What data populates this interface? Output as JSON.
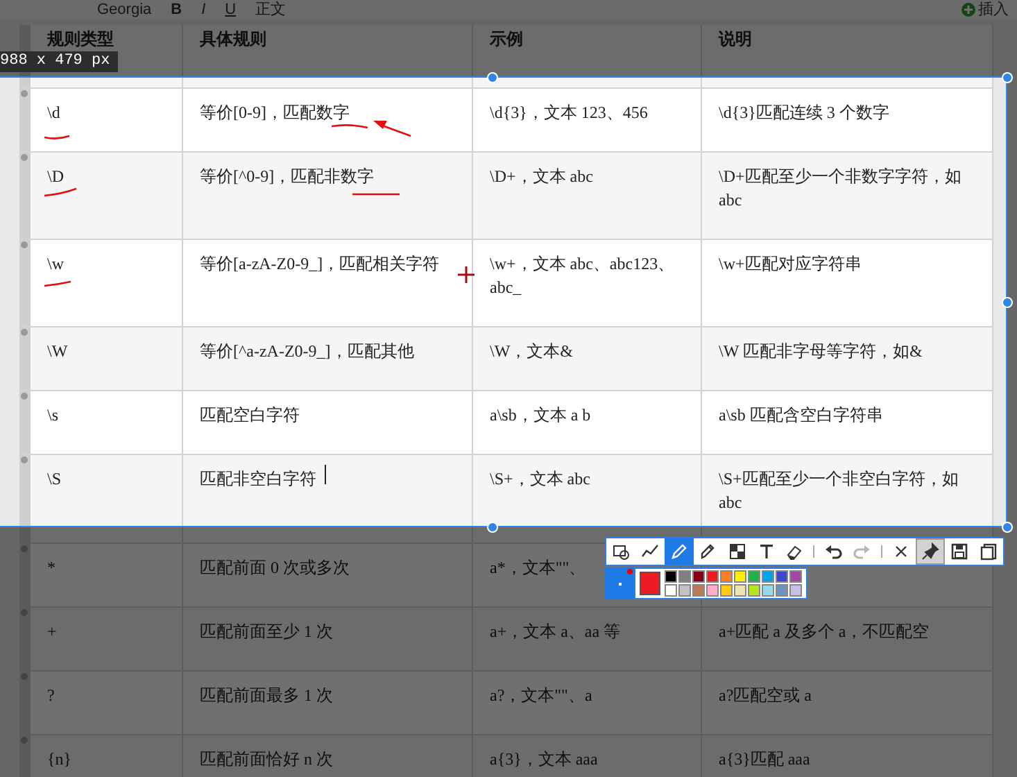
{
  "format_bar": {
    "items": [
      "Georgia",
      "B",
      "I",
      "U",
      "正文",
      "插入"
    ]
  },
  "table": {
    "columns": [
      "规则类型",
      "具体规则",
      "示例",
      "说明"
    ],
    "rows": [
      {
        "cells": [
          "\\d",
          "等价[0-9]，匹配数字",
          "\\d{3}，文本 123、456",
          "\\d{3}匹配连续 3 个数字"
        ]
      },
      {
        "cells": [
          "\\D",
          "等价[^0-9]，匹配非数字",
          "\\D+，文本 abc",
          "\\D+匹配至少一个非数字字符，如abc"
        ]
      },
      {
        "cells": [
          "\\w",
          "等价[a-zA-Z0-9_]，匹配相关字符",
          "\\w+，文本 abc、abc123、abc_",
          "\\w+匹配对应字符串"
        ]
      },
      {
        "cells": [
          "\\W",
          "等价[^a-zA-Z0-9_]，匹配其他",
          "\\W，文本&",
          "\\W 匹配非字母等字符，如&"
        ]
      },
      {
        "cells": [
          "\\s",
          "匹配空白字符",
          "a\\sb，文本 a  b",
          "a\\sb 匹配含空白字符串"
        ]
      },
      {
        "cells": [
          "\\S",
          "匹配非空白字符",
          "\\S+，文本 abc",
          "\\S+匹配至少一个非空白字符，如abc"
        ]
      },
      {
        "cells": [
          "*",
          "匹配前面 0 次或多次",
          "a*，文本\"\"、",
          ""
        ]
      },
      {
        "cells": [
          "+",
          "匹配前面至少 1 次",
          "a+，文本 a、aa 等",
          "a+匹配 a 及多个 a，不匹配空"
        ]
      },
      {
        "cells": [
          "?",
          "匹配前面最多 1 次",
          "a?，文本\"\"、a",
          "a?匹配空或 a"
        ]
      },
      {
        "cells": [
          "{n}",
          "匹配前面恰好 n 次",
          "a{3}，文本 aaa",
          "a{3}匹配 aaa"
        ]
      }
    ]
  },
  "pen_strokes": [
    {
      "kind": "underline"
    },
    {
      "kind": "underline"
    },
    {
      "kind": "underline"
    },
    {
      "kind": "underline"
    },
    {
      "kind": "underline"
    },
    {
      "kind": "arrow"
    }
  ],
  "selection": {
    "size_label": "988 x 479 px"
  },
  "snip_toolbar": {
    "groups": [
      {
        "tools": [
          {
            "kind": "shape",
            "selected": false,
            "on": false,
            "disabled": false
          },
          {
            "kind": "line",
            "selected": false,
            "on": false,
            "disabled": false
          },
          {
            "kind": "pen",
            "selected": true,
            "on": false,
            "disabled": false
          },
          {
            "kind": "marker",
            "selected": false,
            "on": false,
            "disabled": false
          },
          {
            "kind": "mosaic",
            "selected": false,
            "on": false,
            "disabled": false
          },
          {
            "kind": "text",
            "selected": false,
            "on": false,
            "disabled": false
          },
          {
            "kind": "eraser",
            "selected": false,
            "on": false,
            "disabled": false
          }
        ]
      },
      {
        "tools": [
          {
            "kind": "undo",
            "selected": false,
            "on": false,
            "disabled": false
          },
          {
            "kind": "redo",
            "selected": false,
            "on": false,
            "disabled": true
          }
        ]
      },
      {
        "tools": [
          {
            "kind": "close",
            "selected": false,
            "on": false,
            "disabled": false
          },
          {
            "kind": "pin",
            "selected": false,
            "on": true,
            "disabled": false
          },
          {
            "kind": "save",
            "selected": false,
            "on": false,
            "disabled": false
          },
          {
            "kind": "copy",
            "selected": false,
            "on": false,
            "disabled": false
          }
        ]
      }
    ]
  },
  "palette": {
    "current": {
      "color": "#ed1c24"
    },
    "swatches": [
      {
        "color": "#000000"
      },
      {
        "color": "#7f7f7f"
      },
      {
        "color": "#880015"
      },
      {
        "color": "#ed1c24"
      },
      {
        "color": "#ff7f27"
      },
      {
        "color": "#fff200"
      },
      {
        "color": "#22b14c"
      },
      {
        "color": "#00a2e8"
      },
      {
        "color": "#3f48cc"
      },
      {
        "color": "#a349a4"
      },
      {
        "color": "#ffffff"
      },
      {
        "color": "#c3c3c3"
      },
      {
        "color": "#b97a57"
      },
      {
        "color": "#ffaec9"
      },
      {
        "color": "#ffc90e"
      },
      {
        "color": "#efe4b0"
      },
      {
        "color": "#b5e61d"
      },
      {
        "color": "#99d9ea"
      },
      {
        "color": "#7092be"
      },
      {
        "color": "#c8bfe7"
      }
    ]
  }
}
